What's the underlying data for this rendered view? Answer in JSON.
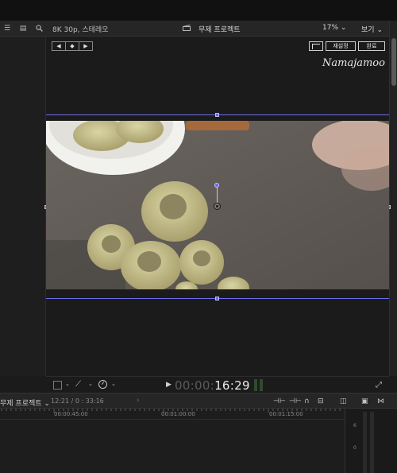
{
  "viewer": {
    "format_label": "8K 30p, 스테레오",
    "project_title": "무제 프로젝트",
    "zoom_label": "17%",
    "view_menu_label": "보기",
    "keyframe_buttons": [
      "◀",
      "◆",
      "▶"
    ],
    "reset_label": "재설정",
    "done_label": "완료",
    "watermark_text": "Namajamoo"
  },
  "playback": {
    "timecode_dim": "00:00:",
    "timecode_lit": "16:29"
  },
  "timeline": {
    "project_menu_label": "무제 프로젝트",
    "duration_text": "12:21 / 0 : 33:16",
    "ruler_labels": [
      "00:00:45:00",
      "00:01:00:00",
      "00:01:15:00"
    ],
    "meter_labels": [
      "6",
      "0"
    ]
  },
  "colors": {
    "accent": "#6a6af2",
    "background": "#1b1b1b",
    "panel": "#262626"
  }
}
